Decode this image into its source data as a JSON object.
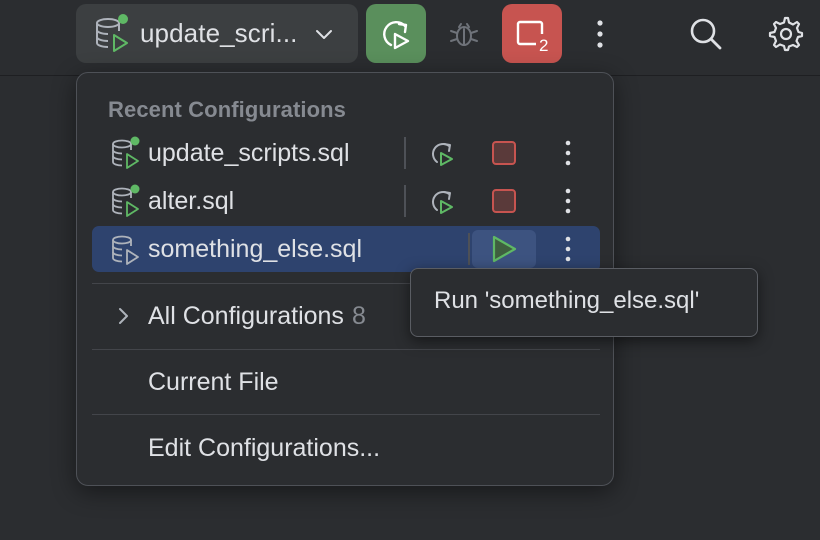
{
  "toolbar": {
    "run_config_name": "update_scri...",
    "buttons": {
      "rerun": "rerun-icon",
      "debug": "debug-icon",
      "stop": "stop-icon",
      "stop_badge": "2",
      "more": "more-vertical-icon",
      "search": "search-icon",
      "settings": "gear-icon"
    }
  },
  "popup": {
    "header": "Recent Configurations",
    "configurations": [
      {
        "label": "update_scripts.sql",
        "running": true,
        "selected": false
      },
      {
        "label": "alter.sql",
        "running": true,
        "selected": false
      },
      {
        "label": "something_else.sql",
        "running": false,
        "selected": true
      }
    ],
    "all_configurations": {
      "label": "All Configurations",
      "count": "8"
    },
    "current_file": "Current File",
    "edit_configurations": "Edit Configurations..."
  },
  "tooltip": {
    "text": "Run 'something_else.sql'"
  },
  "colors": {
    "background": "#2b2d30",
    "widget": "#3c3f41",
    "rerun_green": "#5a8f5c",
    "stop_red": "#c75450",
    "selection": "#2e436e",
    "run_green": "#5fb865",
    "running_dot": "#5fb865"
  }
}
